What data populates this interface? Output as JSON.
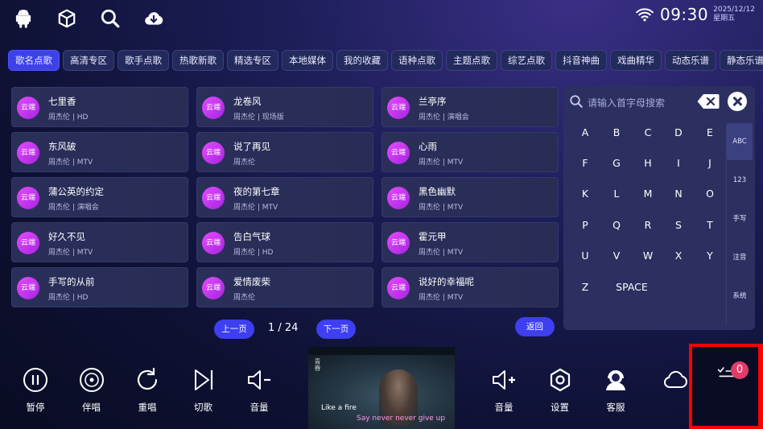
{
  "top_bar": {
    "icons": [
      "android-icon",
      "cube-icon",
      "search-icon",
      "cloud-download-icon"
    ],
    "time": "09:30",
    "date": "2025/12/12",
    "weekday": "星期五"
  },
  "tabs": [
    "歌名点歌",
    "高清专区",
    "歌手点歌",
    "热歌新歌",
    "精选专区",
    "本地媒体",
    "我的收藏",
    "语种点歌",
    "主题点歌",
    "综艺点歌",
    "抖音神曲",
    "戏曲精华",
    "动态乐谱",
    "静态乐谱"
  ],
  "active_tab": 0,
  "cloud_badge": "云端",
  "songs": [
    {
      "title": "七里香",
      "artist": "周杰伦",
      "tag": "HD"
    },
    {
      "title": "龙卷风",
      "artist": "周杰伦",
      "tag": "现场版"
    },
    {
      "title": "兰亭序",
      "artist": "周杰伦",
      "tag": "演唱会"
    },
    {
      "title": "东风破",
      "artist": "周杰伦",
      "tag": "MTV"
    },
    {
      "title": "说了再见",
      "artist": "周杰伦",
      "tag": ""
    },
    {
      "title": "心雨",
      "artist": "周杰伦",
      "tag": "MTV"
    },
    {
      "title": "蒲公英的约定",
      "artist": "周杰伦",
      "tag": "演唱会"
    },
    {
      "title": "夜的第七章",
      "artist": "周杰伦",
      "tag": "MTV"
    },
    {
      "title": "黑色幽默",
      "artist": "周杰伦",
      "tag": "MTV"
    },
    {
      "title": "好久不见",
      "artist": "周杰伦",
      "tag": "MTV"
    },
    {
      "title": "告白气球",
      "artist": "周杰伦",
      "tag": "HD"
    },
    {
      "title": "霍元甲",
      "artist": "周杰伦",
      "tag": "MTV"
    },
    {
      "title": "手写的从前",
      "artist": "周杰伦",
      "tag": "HD"
    },
    {
      "title": "爱情废柴",
      "artist": "周杰伦",
      "tag": ""
    },
    {
      "title": "说好的幸福呢",
      "artist": "周杰伦",
      "tag": "MTV"
    }
  ],
  "pager": {
    "prev": "上一页",
    "current": "1 / 24",
    "next": "下一页",
    "back": "返回"
  },
  "keyboard": {
    "placeholder": "请输入首字母搜索",
    "keys": [
      "A",
      "B",
      "C",
      "D",
      "E",
      "F",
      "G",
      "H",
      "I",
      "J",
      "K",
      "L",
      "M",
      "N",
      "O",
      "P",
      "Q",
      "R",
      "S",
      "T",
      "U",
      "V",
      "W",
      "X",
      "Y",
      "Z",
      "SPACE"
    ],
    "modes": [
      "ABC",
      "123",
      "手写",
      "注音",
      "系统"
    ],
    "active_mode": 0
  },
  "controls": {
    "left": [
      {
        "label": "暂停",
        "icon": "pause-icon"
      },
      {
        "label": "伴唱",
        "icon": "disc-icon"
      },
      {
        "label": "重唱",
        "icon": "replay-icon"
      },
      {
        "label": "切歌",
        "icon": "skip-icon"
      },
      {
        "label": "音量",
        "icon": "volume-down-icon"
      }
    ],
    "right": [
      {
        "label": "音量",
        "icon": "volume-up-icon"
      },
      {
        "label": "设置",
        "icon": "settings-icon"
      },
      {
        "label": "客服",
        "icon": "support-icon"
      }
    ],
    "cloud_icon": "cloud-icon",
    "playlist_count": "0"
  },
  "video": {
    "watermark": "青春",
    "subtitle_1": "Like a fire",
    "subtitle_2": "Say never never give up"
  },
  "colors": {
    "accent": "#3d42e8",
    "badge": "#c33bef",
    "highlight": "#ff0000",
    "counter": "#e23b6a"
  }
}
